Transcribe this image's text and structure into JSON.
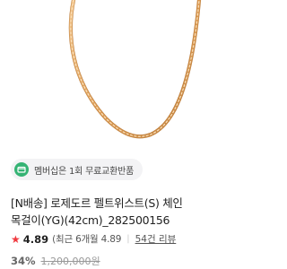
{
  "product": {
    "image_icon": "gold-rope-chain-necklace",
    "benefit_badge": {
      "icon": "membership-badge-icon",
      "text": "멤버십은 1회 무료교환반품"
    },
    "title_lines": [
      "[N배송] 로제도르 펠트위스트(S) 체인",
      "목걸이(YG)(42cm)_282500156"
    ],
    "rating": {
      "icon": "star-icon",
      "score": "4.89",
      "recent": "(최근 6개월 4.89",
      "divider": "|",
      "reviews": "54건 리뷰"
    },
    "price": {
      "discount": "34%",
      "original": "1,200,000원"
    }
  },
  "colors": {
    "gold": "#e3a45c",
    "badge_green": "#35b374",
    "star_red": "#f0393f"
  }
}
